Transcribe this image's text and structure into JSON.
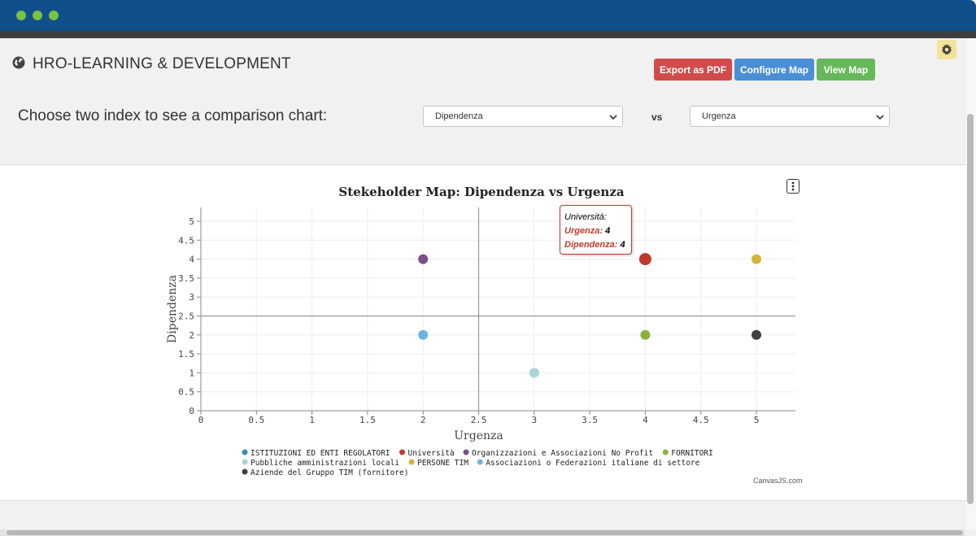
{
  "header": {
    "title": "HRO-LEARNING & DEVELOPMENT",
    "buttons": {
      "export": "Export as PDF",
      "configure": "Configure Map",
      "view": "View Map"
    }
  },
  "comparison": {
    "prompt": "Choose two index to see a comparison chart:",
    "select_a": "Dipendenza",
    "vs": "vs",
    "select_b": "Urgenza"
  },
  "tooltip": {
    "name": "Università:",
    "line1_label": "Urgenza:",
    "line1_value": "4",
    "line2_label": "Dipendenza:",
    "line2_value": "4"
  },
  "credit": "CanvasJS.com",
  "colors": {
    "titlebar": "#0f4f8a",
    "traffic_dot": "#7bc142",
    "export_button": "#d24b4b",
    "configure_button": "#4a8fd6",
    "view_button": "#67b85b",
    "tooltip_border": "#c0392b"
  },
  "icons": [
    "globe-icon",
    "gear-icon",
    "chevron-down-icon",
    "menu-icon"
  ],
  "chart_data": {
    "type": "scatter",
    "title": "Stekeholder Map: Dipendenza vs Urgenza",
    "xlabel": "Urgenza",
    "ylabel": "Dipendenza",
    "xlim": [
      0,
      5
    ],
    "ylim": [
      0,
      5
    ],
    "xticks": [
      "0",
      "0.5",
      "1",
      "1.5",
      "2",
      "2.5",
      "3",
      "3.5",
      "4",
      "4.5",
      "5"
    ],
    "yticks": [
      "0",
      "0.5",
      "1",
      "1.5",
      "2",
      "2.5",
      "3",
      "3.5",
      "4",
      "4.5",
      "5"
    ],
    "quadrant_lines": {
      "x": 2.5,
      "y": 2.5
    },
    "grid": true,
    "legend_position": "bottom",
    "series": [
      {
        "name": "ISTITUZIONI ED ENTI REGOLATORI",
        "color": "#3a8fb7",
        "points": []
      },
      {
        "name": "Università",
        "color": "#c0392b",
        "points": [
          [
            4,
            4
          ]
        ]
      },
      {
        "name": "Organizzazioni e Associazioni No Profit",
        "color": "#7a4f8a",
        "points": [
          [
            2,
            4
          ]
        ]
      },
      {
        "name": "FORNITORI",
        "color": "#8cb33a",
        "points": [
          [
            4,
            2
          ]
        ]
      },
      {
        "name": "Pubbliche amministrazioni locali",
        "color": "#a8d4d6",
        "points": [
          [
            3,
            1
          ]
        ]
      },
      {
        "name": "PERSONE TIM",
        "color": "#d4b53a",
        "points": [
          [
            5,
            4
          ]
        ]
      },
      {
        "name": "Associazioni o Federazioni italiane di settore",
        "color": "#6fb3e3",
        "points": [
          [
            2,
            2
          ]
        ]
      },
      {
        "name": "Aziende del Gruppo TIM (fornitore)",
        "color": "#404040",
        "points": [
          [
            5,
            2
          ]
        ]
      }
    ]
  }
}
